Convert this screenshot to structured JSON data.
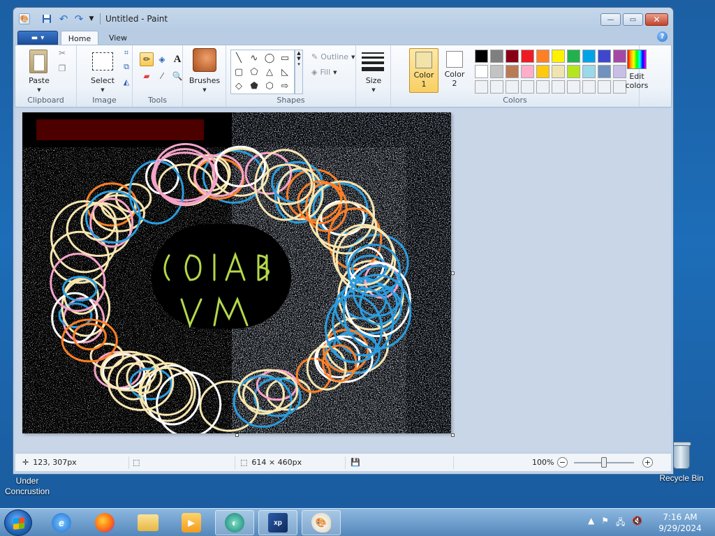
{
  "window": {
    "title": "Untitled - Paint",
    "controls": {
      "minimize": "—",
      "maximize": "▭",
      "close": "✕"
    }
  },
  "ribbon": {
    "tabs": [
      "Home",
      "View"
    ],
    "active_tab": "Home",
    "clipboard": {
      "paste": "Paste",
      "group": "Clipboard"
    },
    "image": {
      "select": "Select",
      "group": "Image"
    },
    "tools": {
      "group": "Tools"
    },
    "brushes": {
      "label": "Brushes"
    },
    "shapes": {
      "outline": "Outline",
      "fill": "Fill",
      "group": "Shapes"
    },
    "size": {
      "label": "Size"
    },
    "colors": {
      "color1_label": "Color",
      "color1_num": "1",
      "color2_label": "Color",
      "color2_num": "2",
      "edit_line1": "Edit",
      "edit_line2": "colors",
      "group": "Colors",
      "color1_value": "#f2e3a8",
      "color2_value": "#ffffff",
      "palette_row1": [
        "#000000",
        "#7f7f7f",
        "#880015",
        "#ed1c24",
        "#ff7f27",
        "#fff200",
        "#22b14c",
        "#00a2e8",
        "#3f48cc",
        "#a349a4"
      ],
      "palette_row2": [
        "#ffffff",
        "#c3c3c3",
        "#b97a57",
        "#ffaec9",
        "#ffc90e",
        "#efe4b0",
        "#b5e61d",
        "#99d9ea",
        "#7092be",
        "#c8bfe7"
      ],
      "custom_slots": 10
    }
  },
  "canvas_text": {
    "line1": "COIAB",
    "line2": "VM"
  },
  "status": {
    "cursor_pos": "123, 307px",
    "canvas_size": "614 × 460px",
    "zoom": "100%",
    "zoom_level": 0.5
  },
  "desktop": {
    "icon1_line1": "Under",
    "icon1_line2": "Concrustion",
    "icon2": "Recycle Bin"
  },
  "taskbar": {
    "time": "7:16 AM",
    "date": "9/29/2024",
    "apps": [
      "internet-explorer",
      "firefox",
      "file-explorer",
      "media-player",
      "app-green",
      "vmware-xp",
      "paint"
    ]
  }
}
